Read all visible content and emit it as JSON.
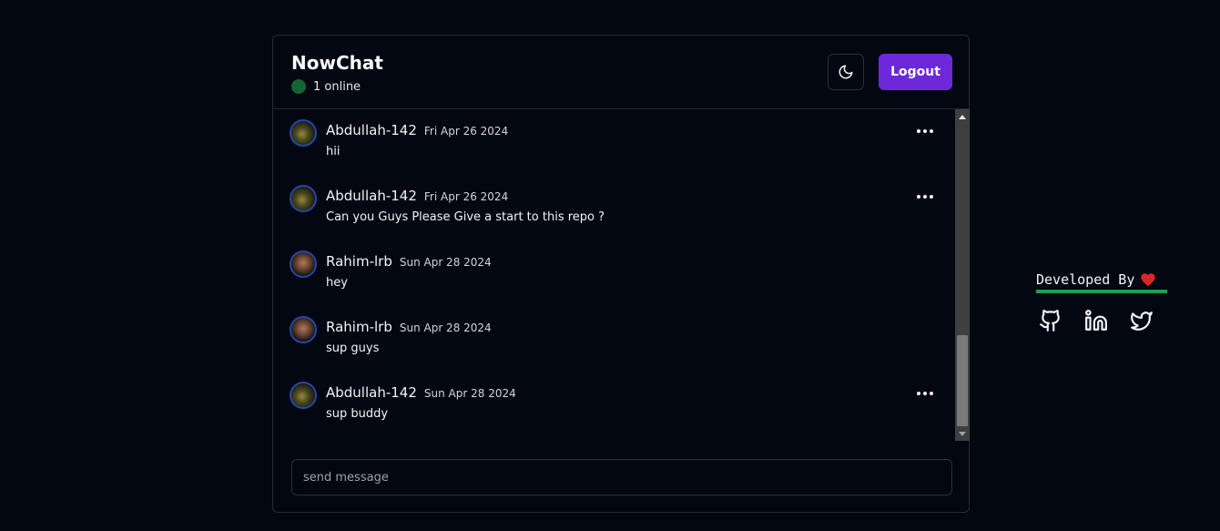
{
  "header": {
    "title": "NowChat",
    "online": "1 online",
    "logout_label": "Logout"
  },
  "theme_icon": "moon-icon",
  "messages": [
    {
      "user": "Abdullah-142",
      "date": "Fri Apr 26 2024",
      "text": "hii",
      "avatar": "abdullah"
    },
    {
      "user": "Abdullah-142",
      "date": "Fri Apr 26 2024",
      "text": "Can you Guys Please Give a start to this repo ?",
      "avatar": "abdullah"
    },
    {
      "user": "Rahim-lrb",
      "date": "Sun Apr 28 2024",
      "text": "hey",
      "avatar": "rahim"
    },
    {
      "user": "Rahim-lrb",
      "date": "Sun Apr 28 2024",
      "text": "sup guys",
      "avatar": "rahim"
    },
    {
      "user": "Abdullah-142",
      "date": "Sun Apr 28 2024",
      "text": "sup buddy",
      "avatar": "abdullah"
    }
  ],
  "composer": {
    "placeholder": "send message",
    "value": ""
  },
  "developer": {
    "label": "Developed By",
    "socials": [
      "github-icon",
      "linkedin-icon",
      "twitter-icon"
    ]
  },
  "colors": {
    "background": "#030712",
    "accent": "#6d28d9",
    "online": "#166534",
    "underline": "#16a34a",
    "heart": "#dc2626"
  }
}
